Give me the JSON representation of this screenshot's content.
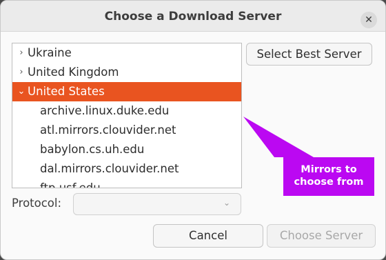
{
  "dialog": {
    "title": "Choose a Download Server",
    "close_symbol": "✕"
  },
  "tree": {
    "items": [
      {
        "label": "Ukraine",
        "expander": "›",
        "selected": false,
        "level": 0
      },
      {
        "label": "United Kingdom",
        "expander": "›",
        "selected": false,
        "level": 0
      },
      {
        "label": "United States",
        "expander": "⌄",
        "selected": true,
        "level": 0
      },
      {
        "label": "archive.linux.duke.edu",
        "level": 1
      },
      {
        "label": "atl.mirrors.clouvider.net",
        "level": 1
      },
      {
        "label": "babylon.cs.uh.edu",
        "level": 1
      },
      {
        "label": "dal.mirrors.clouvider.net",
        "level": 1
      },
      {
        "label": "ftp.usf.edu",
        "level": 1
      }
    ]
  },
  "buttons": {
    "select_best": "Select Best Server",
    "cancel": "Cancel",
    "choose": "Choose Server"
  },
  "protocol": {
    "label": "Protocol:",
    "value": "",
    "caret": "⌄"
  },
  "annotation": {
    "text": "Mirrors to choose from",
    "color": "#bb08f2"
  },
  "colors": {
    "selection": "#e95420"
  }
}
